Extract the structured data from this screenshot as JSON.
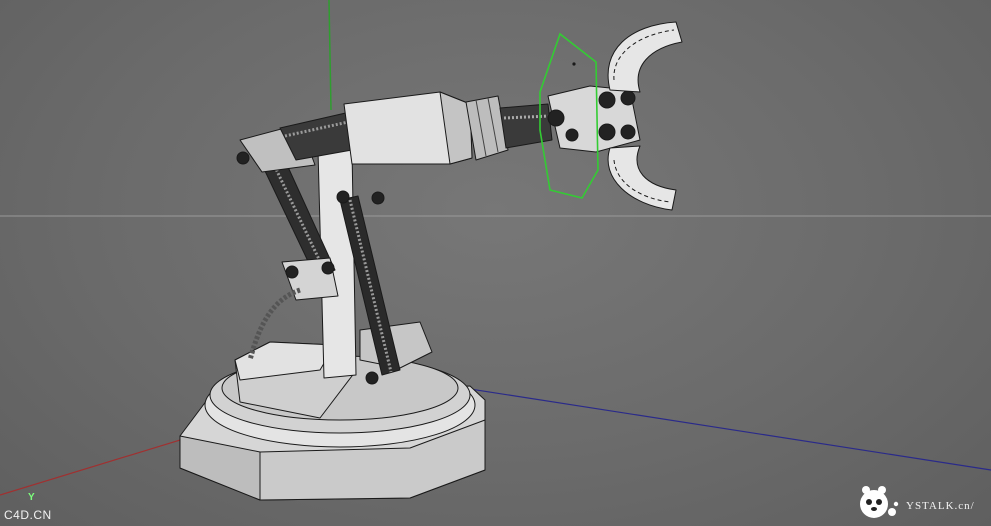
{
  "viewport": {
    "watermark_left": "C4D.CN",
    "watermark_right": "YSTALK.cn/",
    "axis_label_y": "Y"
  },
  "colors": {
    "background": "#6e6e6e",
    "axis_x": "#a03030",
    "axis_y": "#2f9e2f",
    "axis_z": "#2a2a8a",
    "horizon": "#9a9a9a",
    "selection": "#33cc33",
    "model_face": "#d8d8d8",
    "model_edge": "#1a1a1a"
  },
  "icons": {
    "mascot": "mascot-logo-icon"
  }
}
